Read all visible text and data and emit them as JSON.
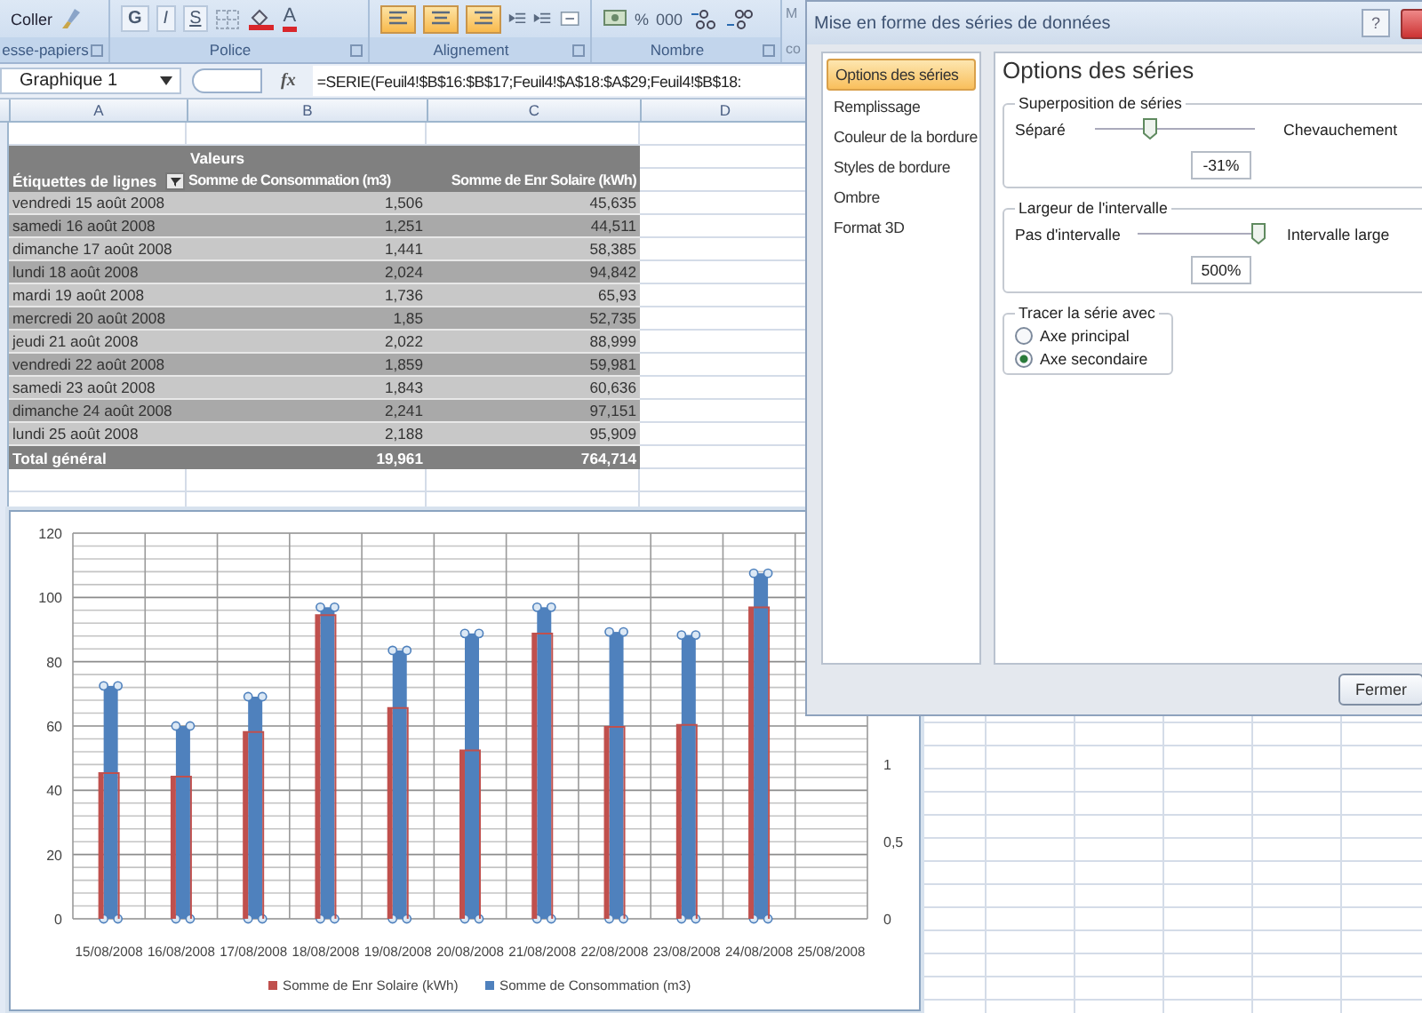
{
  "ribbon": {
    "paste_label": "Coller",
    "font_buttons": [
      "G",
      "I",
      "S"
    ],
    "font_color": "A",
    "align_buttons": [
      {
        "selected": true
      },
      {
        "selected": true
      },
      {
        "selected": true
      }
    ],
    "number_buttons": [
      "%",
      "000"
    ],
    "cut_group": [
      "M",
      "co"
    ],
    "groups": [
      "esse-papiers",
      "Police",
      "Alignement",
      "Nombre"
    ]
  },
  "formula_bar": {
    "name_box": "Graphique 1",
    "fx": "fx",
    "formula": "=SERIE(Feuil4!$B$16:$B$17;Feuil4!$A$18:$A$29;Feuil4!$B$18:"
  },
  "columns": [
    "A",
    "B",
    "C",
    "D"
  ],
  "pivot": {
    "values_label": "Valeurs",
    "headers": [
      "Étiquettes de lignes",
      "Somme de Consommation (m3)",
      "Somme de Enr Solaire (kWh)"
    ],
    "rows": [
      {
        "label": "vendredi 15 août 2008",
        "consommation": "1,506",
        "solaire": "45,635"
      },
      {
        "label": "samedi 16 août 2008",
        "consommation": "1,251",
        "solaire": "44,511"
      },
      {
        "label": "dimanche 17 août 2008",
        "consommation": "1,441",
        "solaire": "58,385"
      },
      {
        "label": "lundi 18 août 2008",
        "consommation": "2,024",
        "solaire": "94,842"
      },
      {
        "label": "mardi 19 août 2008",
        "consommation": "1,736",
        "solaire": "65,93"
      },
      {
        "label": "mercredi 20 août 2008",
        "consommation": "1,85",
        "solaire": "52,735"
      },
      {
        "label": "jeudi 21 août 2008",
        "consommation": "2,022",
        "solaire": "88,999"
      },
      {
        "label": "vendredi 22 août 2008",
        "consommation": "1,859",
        "solaire": "59,981"
      },
      {
        "label": "samedi 23 août 2008",
        "consommation": "1,843",
        "solaire": "60,636"
      },
      {
        "label": "dimanche 24 août 2008",
        "consommation": "2,241",
        "solaire": "97,151"
      },
      {
        "label": "lundi 25 août 2008",
        "consommation": "2,188",
        "solaire": "95,909"
      }
    ],
    "total": {
      "label": "Total général",
      "consommation": "19,961",
      "solaire": "764,714"
    }
  },
  "chart": {
    "chart_data": {
      "type": "bar",
      "categories": [
        "15/08/2008",
        "16/08/2008",
        "17/08/2008",
        "18/08/2008",
        "19/08/2008",
        "20/08/2008",
        "21/08/2008",
        "22/08/2008",
        "23/08/2008",
        "24/08/2008",
        "25/08/2008"
      ],
      "series": [
        {
          "name": "Somme de Enr Solaire (kWh)",
          "color": "#c0504d",
          "values": [
            45.6,
            44.5,
            58.4,
            94.8,
            65.9,
            52.7,
            89.0,
            60.0,
            60.6,
            97.2,
            null
          ]
        },
        {
          "name": "Somme de Consommation (m3)",
          "color": "#4f81bd",
          "axis": "y2",
          "values": [
            1.51,
            1.25,
            1.44,
            2.02,
            1.74,
            1.85,
            2.02,
            1.86,
            1.84,
            2.24,
            null
          ]
        }
      ],
      "grid": true,
      "legend": "bottom",
      "ylim": [
        0,
        120
      ],
      "yticks": [
        0,
        20,
        40,
        60,
        80,
        100,
        120
      ],
      "y2lim": [
        0,
        2.5
      ],
      "y2ticks": [
        0,
        {
          "value": 0.5,
          "label": "0,5"
        },
        1
      ]
    }
  },
  "dialog": {
    "title": "Mise en forme des séries de données",
    "help": "?",
    "nav": [
      {
        "label": "Options des séries",
        "selected": true
      },
      {
        "label": "Remplissage",
        "selected": false
      },
      {
        "label": "Couleur de la bordure",
        "selected": false
      },
      {
        "label": "Styles de bordure",
        "selected": false
      },
      {
        "label": "Ombre",
        "selected": false
      },
      {
        "label": "Format 3D",
        "selected": false
      }
    ],
    "heading": "Options des séries",
    "overlap": {
      "legend": "Superposition de séries",
      "min_label": "Séparé",
      "max_label": "Chevauchement",
      "level": 0.345,
      "value": "-31%"
    },
    "gap": {
      "legend": "Largeur de l'intervalle",
      "min_label": "Pas d'intervalle",
      "max_label": "Intervalle large",
      "level": 1,
      "value": "500%"
    },
    "plot_on": {
      "legend": "Tracer la série avec",
      "options": [
        {
          "label": "Axe principal",
          "selected": false
        },
        {
          "label": "Axe secondaire",
          "selected": true
        }
      ]
    },
    "close_button": "Fermer"
  }
}
